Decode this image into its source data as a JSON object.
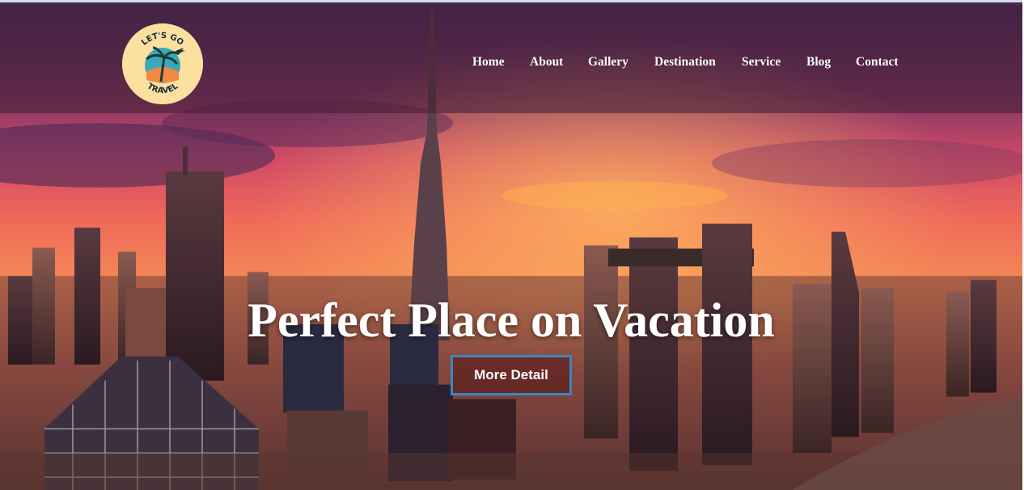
{
  "brand": {
    "logo_top_text": "LET'S GO",
    "logo_bottom_text": "TRAVEL",
    "icon": "palm-tree-airplane-icon"
  },
  "nav": {
    "items": [
      {
        "label": "Home"
      },
      {
        "label": "About"
      },
      {
        "label": "Gallery"
      },
      {
        "label": "Destination"
      },
      {
        "label": "Service"
      },
      {
        "label": "Blog"
      },
      {
        "label": "Contact"
      }
    ]
  },
  "hero": {
    "headline": "Perfect Place on Vacation",
    "cta_label": "More Detail"
  },
  "colors": {
    "cta_border": "#3a88c0",
    "logo_bg": "#fbe0a0",
    "text": "#ffffff"
  }
}
